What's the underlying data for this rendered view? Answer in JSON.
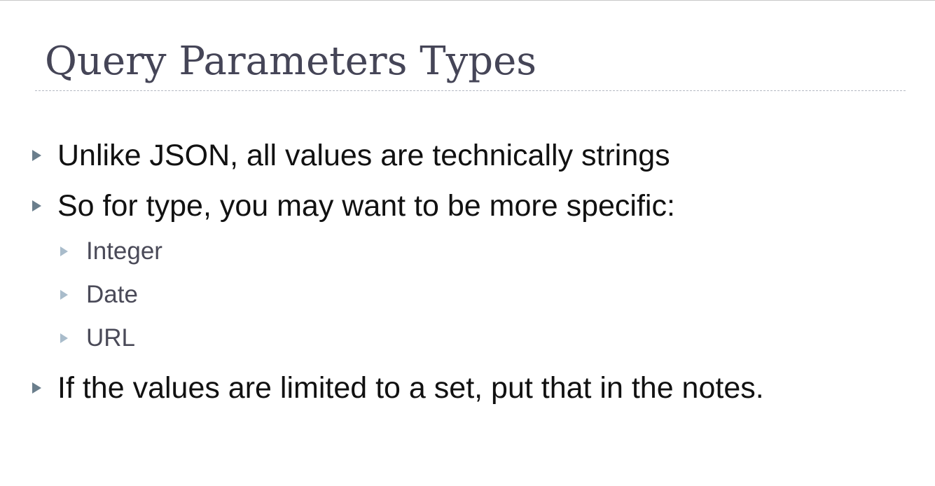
{
  "slide": {
    "title": "Query Parameters Types",
    "bullets": [
      {
        "level": 1,
        "text": "Unlike JSON, all values are technically strings"
      },
      {
        "level": 1,
        "text": "So for type, you may want to be more specific:"
      },
      {
        "level": 2,
        "text": "Integer"
      },
      {
        "level": 2,
        "text": "Date"
      },
      {
        "level": 2,
        "text": "URL"
      },
      {
        "level": 1,
        "text": "If the values are limited to a set, put that in the notes."
      }
    ]
  },
  "colors": {
    "title": "#454557",
    "level1_text": "#111111",
    "level2_text": "#4a4a58",
    "level1_marker": "#6a7e8c",
    "level2_marker": "#a9bccb",
    "rule": "#b4b9c3"
  },
  "icons": {
    "level1_marker": "triangle-bullet-icon",
    "level2_marker": "triangle-bullet-icon"
  }
}
